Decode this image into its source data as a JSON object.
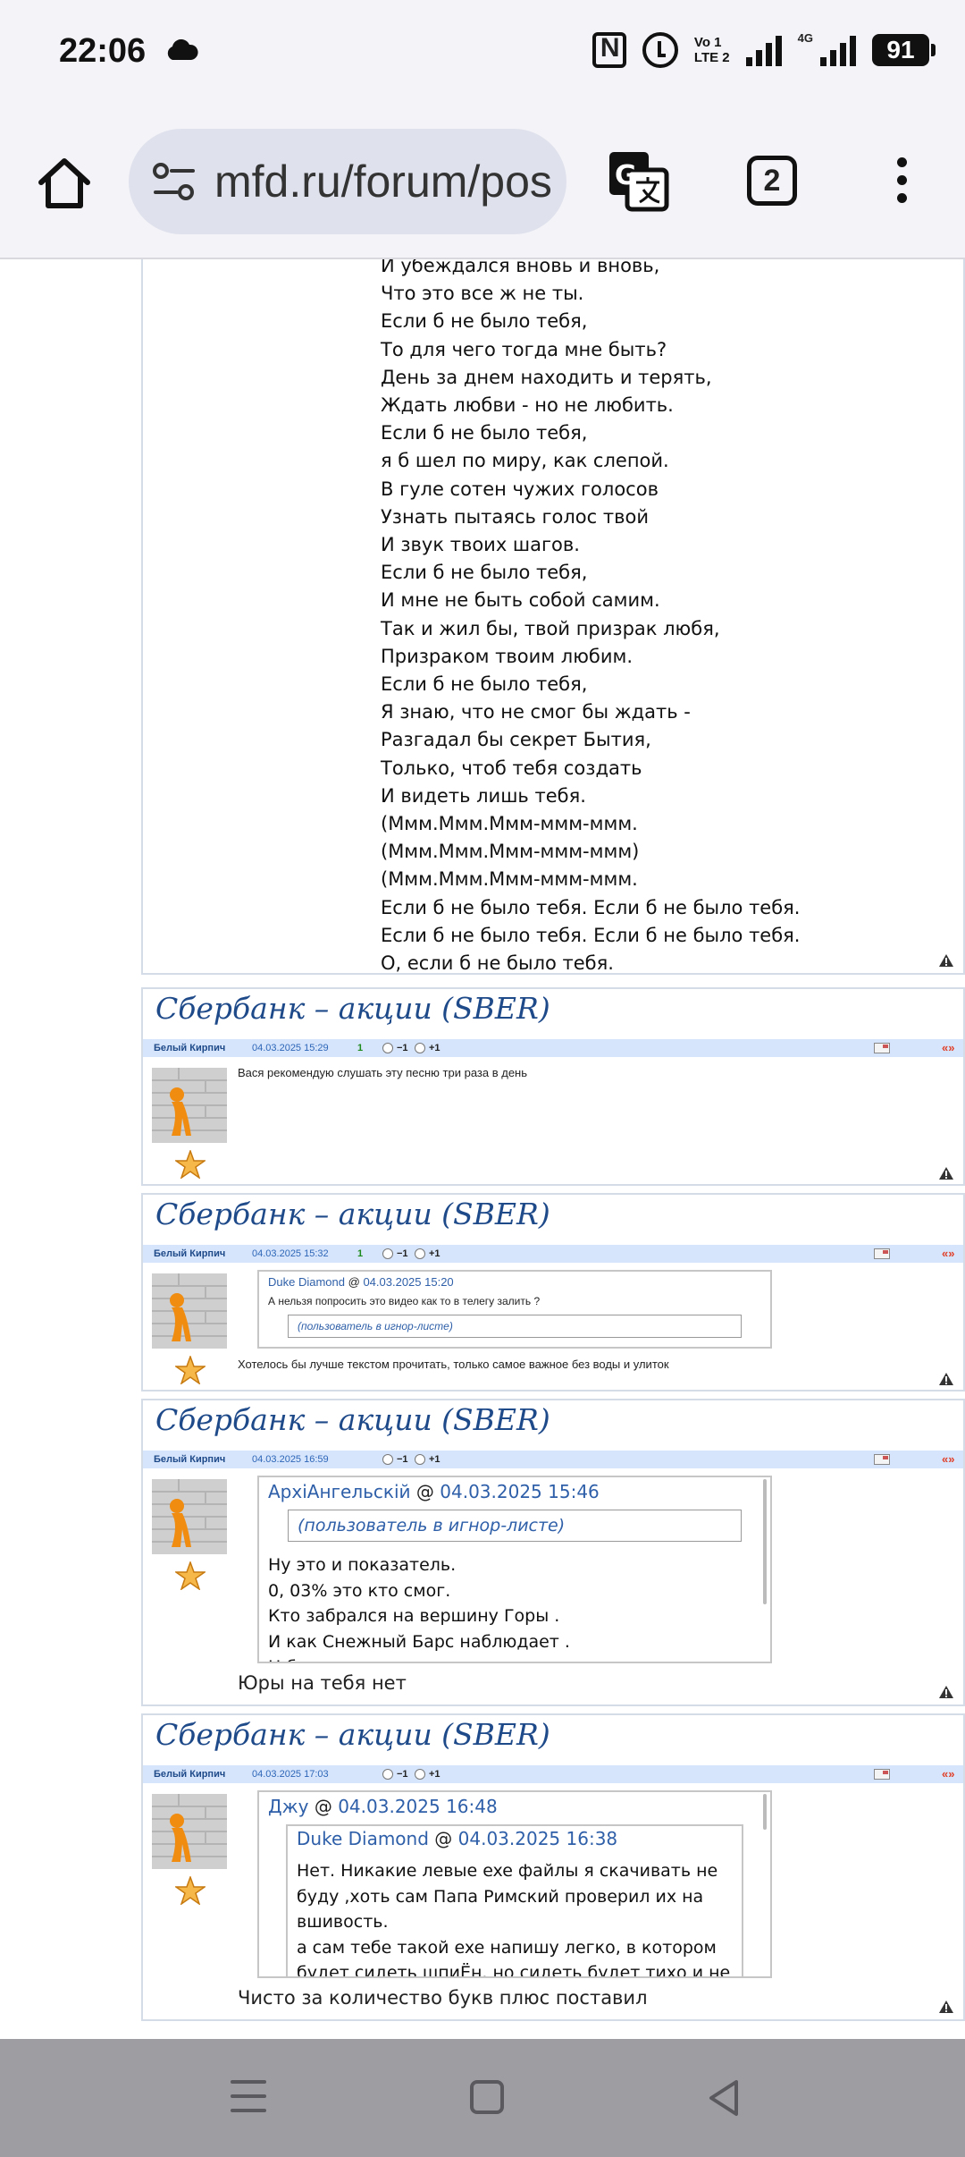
{
  "status_bar": {
    "time": "22:06",
    "volte_top": "Vo 1",
    "volte_bottom": "LTE 2",
    "network": "4G",
    "battery": "91"
  },
  "browser": {
    "url": "mfd.ru/forum/pos",
    "tab_count": "2"
  },
  "poem": {
    "lines": [
      "И убеждался вновь и вновь,",
      "Что это все ж не ты.",
      "Если б не было тебя,",
      "То для чего тогда мне быть?",
      "День за днем находить и терять,",
      "Ждать любви - но не любить.",
      "Если б не было тебя,",
      "я б шел по миру, как слепой.",
      "В гуле сотен чужих голосов",
      "Узнать пытаясь голос твой",
      "И звук твоих шагов.",
      "Если б не было тебя,",
      "И мне не быть собой самим.",
      "Так и жил бы, твой призрак любя,",
      "Призраком твоим любим.",
      "Если б не было тебя,",
      "Я знаю, что не смог бы ждать -",
      "Разгадал бы секрет Бытия,",
      "Только, чтоб тебя создать",
      "И видеть лишь тебя.",
      "(Ммм.Ммм.Ммм-ммм-ммм.",
      "(Ммм.Ммм.Ммм-ммм-ммм)",
      "(Ммм.Ммм.Ммм-ммм-ммм.",
      "Если б не было тебя. Если б не было тебя.",
      "Если б не было тебя. Если б не было тебя.",
      "О, если б не было тебя."
    ]
  },
  "posts": [
    {
      "title": "Сбербанк – акции (SBER)",
      "author": "Белый Кирпич",
      "date": "04.03.2025 15:29",
      "score": "1",
      "vote_minus": "−1",
      "vote_plus": "+1",
      "quote_arrows": "«»",
      "text": "Вася рекомендую слушать эту песню три раза в день"
    },
    {
      "title": "Сбербанк – акции (SBER)",
      "author": "Белый Кирпич",
      "date": "04.03.2025 15:32",
      "score": "1",
      "vote_minus": "−1",
      "vote_plus": "+1",
      "quote_arrows": "«»",
      "quote": {
        "author": "Duke Diamond",
        "at": "@",
        "date": "04.03.2025 15:20",
        "text": "А нельзя попросить это видео как то в телегу залить ?",
        "ignore_prefix": "(пользователь в ",
        "ignore_link": "игнор-листе",
        "ignore_suffix": ")"
      },
      "text": "Хотелось бы лучше текстом прочитать, только самое важное без воды и улиток"
    },
    {
      "title": "Сбербанк – акции (SBER)",
      "author": "Белый Кирпич",
      "date": "04.03.2025 16:59",
      "score": "",
      "vote_minus": "−1",
      "vote_plus": "+1",
      "quote_arrows": "«»",
      "quote": {
        "author": "АрхiАнгельскiй",
        "at": "@",
        "date": "04.03.2025 15:46",
        "ignore_prefix": "(пользователь в ",
        "ignore_link": "игнор-листе",
        "ignore_suffix": ")",
        "lines": [
          "Ну это и показатель.",
          "0, 03% это кто смог.",
          "Кто забрался на вершину Горы .",
          "И как Снежный Барс наблюдает .",
          "Н б"
        ]
      },
      "text": "Юры на тебя нет"
    },
    {
      "title": "Сбербанк – акции (SBER)",
      "author": "Белый Кирпич",
      "date": "04.03.2025 17:03",
      "score": "",
      "vote_minus": "−1",
      "vote_plus": "+1",
      "quote_arrows": "«»",
      "quote": {
        "author": "Джу",
        "at": "@",
        "date": "04.03.2025 16:48",
        "nested": {
          "author": "Duke Diamond",
          "at": "@",
          "date": "04.03.2025 16:38",
          "lines": [
            "Нет. Никакие левые exe файлы я скачивать не",
            "буду ,хоть сам Папа Римский проверил их на",
            "вшивость.",
            "а сам тебе такой exe напишу легко, в котором",
            "будет сидеть шпиЁн. но сидеть будет тихо и не"
          ]
        }
      },
      "text": "Чисто за количество букв плюс поставил"
    }
  ]
}
